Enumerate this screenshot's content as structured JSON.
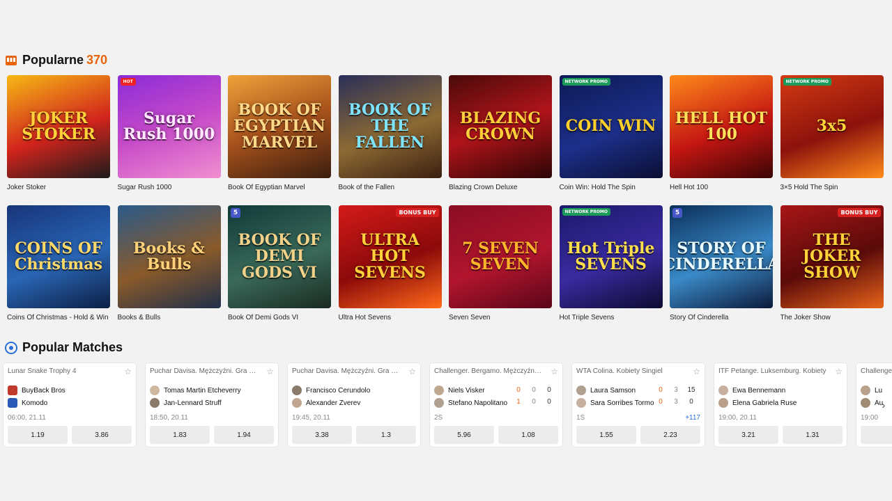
{
  "popular": {
    "title": "Popularne",
    "count": "370",
    "games": [
      {
        "name": "Joker Stoker",
        "art": "JOKER STOKER",
        "bg": "linear-gradient(160deg,#f6b915,#d2241c 55%,#1b1b1b)",
        "fg": "#ffd23a",
        "badge": ""
      },
      {
        "name": "Sugar Rush 1000",
        "art": "Sugar Rush 1000",
        "bg": "linear-gradient(160deg,#8c2bd8,#c64ac9 50%,#f08fd0)",
        "fg": "#ffe8ff",
        "badge": "HOT"
      },
      {
        "name": "Book Of Egyptian Marvel",
        "art": "BOOK OF EGYPTIAN MARVEL",
        "bg": "linear-gradient(160deg,#f0a23a,#a8521c 50%,#3a1d0e)",
        "fg": "#ffd98a",
        "badge": ""
      },
      {
        "name": "Book of the Fallen",
        "art": "BOOK OF THE FALLEN",
        "bg": "linear-gradient(160deg,#2a2f58,#8d6a34 55%,#3b1f10)",
        "fg": "#7de3ff",
        "badge": ""
      },
      {
        "name": "Blazing Crown Deluxe",
        "art": "BLAZING CROWN",
        "bg": "linear-gradient(160deg,#4a0a0a,#b0141a 50%,#2b0505)",
        "fg": "#ffcf3a",
        "badge": ""
      },
      {
        "name": "Coin Win: Hold The Spin",
        "art": "COIN WIN",
        "bg": "linear-gradient(160deg,#0d1a55,#1d2f8a 55%,#0a0f33)",
        "fg": "#ffd02a",
        "badge": "NETWORK PROMO"
      },
      {
        "name": "Hell Hot 100",
        "art": "HELL HOT 100",
        "bg": "linear-gradient(160deg,#ff8a1a,#c41612 55%,#3b0505)",
        "fg": "#ffe05a",
        "badge": ""
      },
      {
        "name": "3×5 Hold The Spin",
        "art": "3x5",
        "bg": "linear-gradient(160deg,#d43a12,#8c120c 55%,#ff8c1a)",
        "fg": "#ffd53a",
        "badge": "NETWORK PROMO"
      },
      {
        "name": "Coins Of Christmas - Hold & Win",
        "art": "COINS OF Christmas",
        "bg": "linear-gradient(160deg,#17357a,#2a66b5 55%,#0c1f44)",
        "fg": "#ffd86a",
        "badge": ""
      },
      {
        "name": "Books & Bulls",
        "art": "Books & Bulls",
        "bg": "linear-gradient(160deg,#2a5a8a,#8a5a2a 55%,#1f2f4a)",
        "fg": "#ffd27a",
        "badge": ""
      },
      {
        "name": "Book Of Demi Gods VI",
        "art": "BOOK OF DEMI GODS VI",
        "bg": "linear-gradient(160deg,#0f3a3a,#3a6a5a 55%,#1a2a20)",
        "fg": "#f2d28a",
        "badge": "5"
      },
      {
        "name": "Ultra Hot Sevens",
        "art": "ULTRA HOT SEVENS",
        "bg": "linear-gradient(160deg,#d41a1a,#8c0a0a 55%,#ff6a1a)",
        "fg": "#ffd23a",
        "badge": "BONUS BUY"
      },
      {
        "name": "Seven Seven",
        "art": "7 SEVEN SEVEN",
        "bg": "linear-gradient(160deg,#8a0d24,#b2152e 55%,#5a0618)",
        "fg": "#ffb52a",
        "badge": ""
      },
      {
        "name": "Hot Triple Sevens",
        "art": "Hot Triple SEVENS",
        "bg": "linear-gradient(160deg,#1a1a6a,#3a2aa0 55%,#0c0c30)",
        "fg": "#ffe04a",
        "badge": "NETWORK PROMO"
      },
      {
        "name": "Story Of Cinderella",
        "art": "STORY OF CINDERELLA",
        "bg": "linear-gradient(160deg,#0b2f5a,#3a8ac8 55%,#0c1a3a)",
        "fg": "#e8fbff",
        "badge": "5"
      },
      {
        "name": "The Joker Show",
        "art": "THE JOKER SHOW",
        "bg": "linear-gradient(160deg,#a81616,#5a0a0a 55%,#e8641a)",
        "fg": "#ffd23a",
        "badge": "BONUS BUY"
      }
    ]
  },
  "matches_section": {
    "title": "Popular Matches",
    "matches": [
      {
        "league": "Lunar Snake Trophy 4",
        "team1": "BuyBack Bros",
        "team2": "Komodo",
        "time": "06:00, 21.11",
        "odd1": "1.19",
        "odd2": "3.86",
        "more": "",
        "score1": [],
        "score2": [],
        "kind": "esport"
      },
      {
        "league": "Puchar Davisa. Mężczyźni. Gra podwójna",
        "team1": "Tomas Martin Etcheverry",
        "team2": "Jan-Lennard Struff",
        "time": "18:50, 20.11",
        "odd1": "1.83",
        "odd2": "1.94",
        "more": "",
        "score1": [],
        "score2": [],
        "kind": "player"
      },
      {
        "league": "Puchar Davisa. Mężczyźni. Gra pojedyncza",
        "team1": "Francisco Cerundolo",
        "team2": "Alexander Zverev",
        "time": "19:45, 20.11",
        "odd1": "3.38",
        "odd2": "1.3",
        "more": "",
        "score1": [],
        "score2": [],
        "kind": "player"
      },
      {
        "league": "Challenger. Bergamo. Mężczyźni. Singiel",
        "team1": "Niels Visker",
        "team2": "Stefano Napolitano",
        "time": "2S",
        "odd1": "5.96",
        "odd2": "1.08",
        "more": "",
        "score1": [
          "0",
          "0",
          "0"
        ],
        "score2": [
          "1",
          "0",
          "0"
        ],
        "kind": "player"
      },
      {
        "league": "WTA Colina. Kobiety Singiel",
        "team1": "Laura Samson",
        "team2": "Sara Sorribes Tormo",
        "time": "1S",
        "odd1": "1.55",
        "odd2": "2.23",
        "more": "+117",
        "score1": [
          "0",
          "3",
          "15"
        ],
        "score2": [
          "0",
          "3",
          "0"
        ],
        "kind": "player"
      },
      {
        "league": "ITF Petange. Luksemburg. Kobiety",
        "team1": "Ewa Bennemann",
        "team2": "Elena Gabriela Ruse",
        "time": "19:00, 20.11",
        "odd1": "3.21",
        "odd2": "1.31",
        "more": "",
        "score1": [],
        "score2": [],
        "kind": "player"
      },
      {
        "league": "Challenger",
        "team1": "Lu",
        "team2": "Au",
        "time": "19:00",
        "odd1": "",
        "odd2": "",
        "more": "",
        "score1": [],
        "score2": [],
        "kind": "player"
      }
    ]
  },
  "icons": {
    "popular": "slot-machine-icon",
    "matches": "sport-ball-icon",
    "star": "star-icon",
    "next": "chevron-right-icon"
  },
  "colors": {
    "accent": "#e8640c",
    "link": "#2a6ed8",
    "background": "#f2f2f2"
  }
}
